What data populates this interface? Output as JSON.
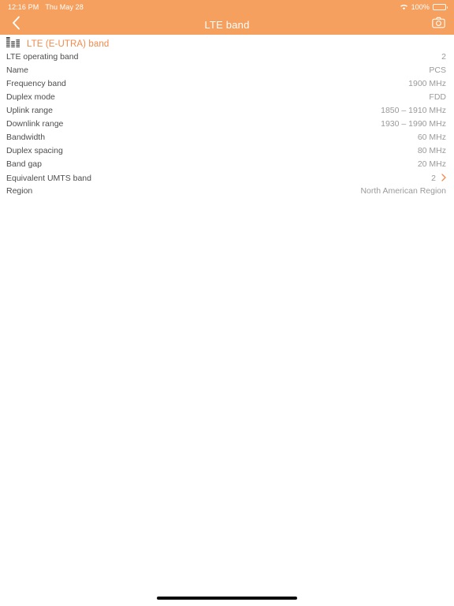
{
  "statusbar": {
    "time": "12:16 PM",
    "date": "Thu May 28",
    "wifi_icon": "wifi-icon",
    "battery_percent": "100%",
    "battery_icon": "battery-icon"
  },
  "navbar": {
    "back_icon": "chevron-left-icon",
    "title": "LTE band",
    "camera_icon": "camera-icon"
  },
  "section": {
    "icon": "bar-chart-icon",
    "title": "LTE (E-UTRA) band"
  },
  "rows": [
    {
      "label": "LTE operating band",
      "value": "2",
      "chevron": false
    },
    {
      "label": "Name",
      "value": "PCS",
      "chevron": false
    },
    {
      "label": "Frequency band",
      "value": "1900 MHz",
      "chevron": false
    },
    {
      "label": "Duplex mode",
      "value": "FDD",
      "chevron": false
    },
    {
      "label": "Uplink range",
      "value": "1850 – 1910 MHz",
      "chevron": false
    },
    {
      "label": "Downlink range",
      "value": "1930 – 1990 MHz",
      "chevron": false
    },
    {
      "label": "Bandwidth",
      "value": "60 MHz",
      "chevron": false
    },
    {
      "label": "Duplex spacing",
      "value": "80 MHz",
      "chevron": false
    },
    {
      "label": "Band gap",
      "value": "20 MHz",
      "chevron": false
    },
    {
      "label": "Equivalent UMTS band",
      "value": "2",
      "chevron": true
    },
    {
      "label": "Region",
      "value": "North American Region",
      "chevron": false
    }
  ],
  "colors": {
    "accent_orange": "#f5a05e",
    "section_title": "#f08a4b",
    "label_gray": "#4d4d4d",
    "value_gray": "#9a9a9a",
    "background": "#ffffff",
    "home_indicator": "#0b0b0b"
  },
  "home_indicator": "home-indicator"
}
